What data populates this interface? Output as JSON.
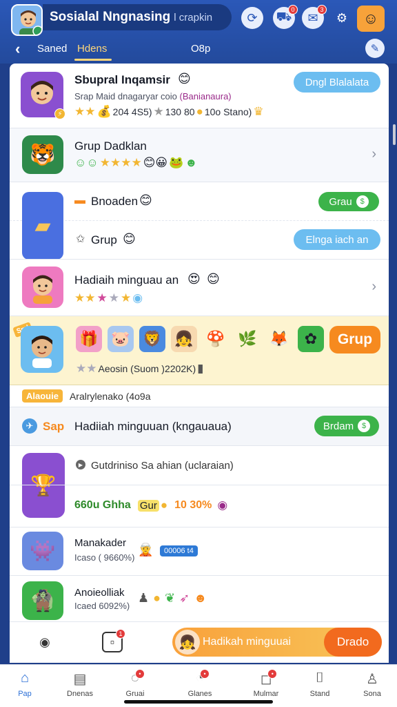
{
  "header": {
    "title": "Sosialal Nngnasing",
    "subtitle": "l crapkin",
    "icons": [
      {
        "name": "sync-icon",
        "glyph": "⟳",
        "badge": ""
      },
      {
        "name": "gift-truck-icon",
        "glyph": "⛟",
        "badge": "0"
      },
      {
        "name": "chat-icon",
        "glyph": "✉",
        "badge": "3"
      },
      {
        "name": "gear-icon",
        "glyph": "⚙",
        "badge": ""
      }
    ]
  },
  "subnav": {
    "tabs": [
      "Saned",
      "Hdens",
      "O8p"
    ]
  },
  "rows": {
    "profile": {
      "title": "Sbupral Inqamsir",
      "sub_prefix": "Srap Maid dnagaryar coio",
      "sub_highlight": "(Banianaura)",
      "stats": "204 4S5)",
      "stats2": "130 80",
      "stats3": "10o Stano)",
      "button": "Dngl Blalalata"
    },
    "grup": {
      "title": "Grup Dadklan"
    },
    "bnoaden": {
      "title": "Bnoaden",
      "button": "Grau"
    },
    "grup2": {
      "title": "Grup",
      "button": "Elnga iach an"
    },
    "hadiah": {
      "title": "Hadiaih minguau an"
    },
    "gift": {
      "caption": "Aeosin (Suom )2202K)",
      "button": "Grup",
      "tag": "Sml"
    },
    "mini": {
      "tag": "Alaouie",
      "text": "Aralrylenako (4o9a"
    },
    "section": {
      "tag": "Sap",
      "title": "Hadiiah minguuan (kngauaua)",
      "button": "Brdam"
    },
    "rewards": {
      "line1": "Gutdriniso Sa ahian (uclaraian)",
      "line2a": "660u Ghha",
      "line2b": "Gur",
      "line2c": "10 30%"
    },
    "manakader": {
      "title": "Manakader",
      "sub": "Icaso ( 9660%)",
      "chip": "00006 t4"
    },
    "anoleolliak": {
      "title": "Anoieolliak",
      "sub": "Icaed 6092%)"
    }
  },
  "bottom_actions": {
    "banner_text": "Hadikah minguuai",
    "banner_button": "Drado"
  },
  "bottom_nav": [
    {
      "label": "Pap",
      "glyph": "⌂",
      "badge": ""
    },
    {
      "label": "Dnenas",
      "glyph": "▤",
      "badge": ""
    },
    {
      "label": "Gruai",
      "glyph": "◌",
      "badge": "•"
    },
    {
      "label": "Glanes",
      "glyph": "◔",
      "badge": "•"
    },
    {
      "label": "Mulmar",
      "glyph": "◻",
      "badge": "•"
    },
    {
      "label": "Stand",
      "glyph": "⌷",
      "badge": ""
    },
    {
      "label": "Sona",
      "glyph": "♙",
      "badge": ""
    }
  ],
  "colors": {
    "brand_blue": "#2b58b8",
    "accent_green": "#3cb34a",
    "accent_orange": "#f68a1f",
    "accent_sky": "#6cbdf0"
  }
}
